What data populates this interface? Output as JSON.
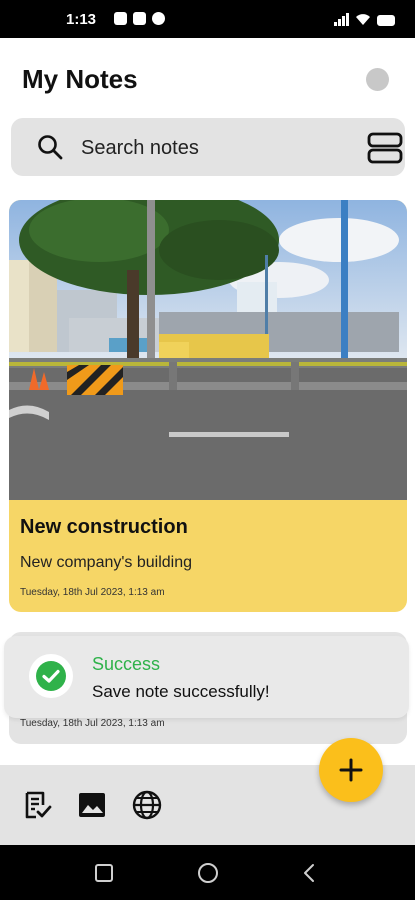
{
  "status_bar": {
    "time": "1:13"
  },
  "header": {
    "title": "My Notes"
  },
  "search": {
    "placeholder": "Search notes"
  },
  "notes": [
    {
      "title": "New construction",
      "subtitle": "New company's building",
      "date": "Tuesday, 18th Jul 2023, 1:13 am",
      "color": "#f6d666"
    },
    {
      "date": "Tuesday, 18th Jul 2023, 1:13 am",
      "color": "#e3e3e3"
    }
  ],
  "toast": {
    "title": "Success",
    "message": "Save note successfully!",
    "color": "#2fb24a"
  },
  "bottom_bar": {
    "icons": [
      "checklist-icon",
      "image-icon",
      "globe-icon"
    ]
  },
  "fab": {
    "icon": "plus-icon",
    "color": "#fbbf1b"
  },
  "android_nav": {
    "icons": [
      "recents-icon",
      "home-icon",
      "back-icon"
    ]
  }
}
